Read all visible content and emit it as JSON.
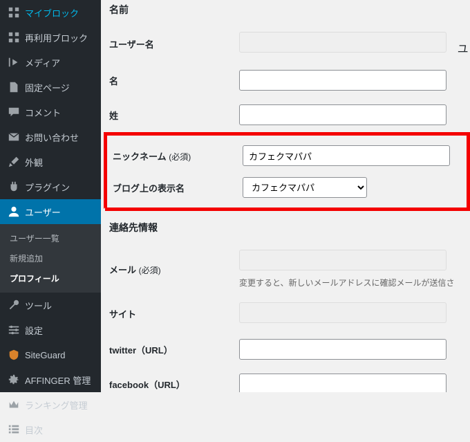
{
  "sidebar": {
    "items": [
      {
        "label": "マイブロック"
      },
      {
        "label": "再利用ブロック"
      },
      {
        "label": "メディア"
      },
      {
        "label": "固定ページ"
      },
      {
        "label": "コメント"
      },
      {
        "label": "お問い合わせ"
      },
      {
        "label": "外観"
      },
      {
        "label": "プラグイン"
      },
      {
        "label": "ユーザー"
      },
      {
        "label": "ツール"
      },
      {
        "label": "設定"
      },
      {
        "label": "SiteGuard"
      },
      {
        "label": "AFFINGER 管理"
      },
      {
        "label": "ランキング管理"
      },
      {
        "label": "目次"
      }
    ],
    "submenu": {
      "items": [
        "ユーザー一覧",
        "新規追加",
        "プロフィール"
      ]
    }
  },
  "main": {
    "section_name": "名前",
    "section_contact": "連絡先情報",
    "labels": {
      "username": "ユーザー名",
      "firstname": "名",
      "lastname": "姓",
      "nickname": "ニックネーム",
      "displayname": "ブログ上の表示名",
      "email": "メール",
      "site": "サイト",
      "twitter": "twitter（URL）",
      "facebook": "facebook（URL）",
      "required": "(必須)"
    },
    "values": {
      "nickname": "カフェクマパパ",
      "displayname": "カフェクマパパ",
      "username_suffix": "ユ"
    },
    "help": {
      "email": "変更すると、新しいメールアドレスに確認メールが送信さ"
    }
  }
}
